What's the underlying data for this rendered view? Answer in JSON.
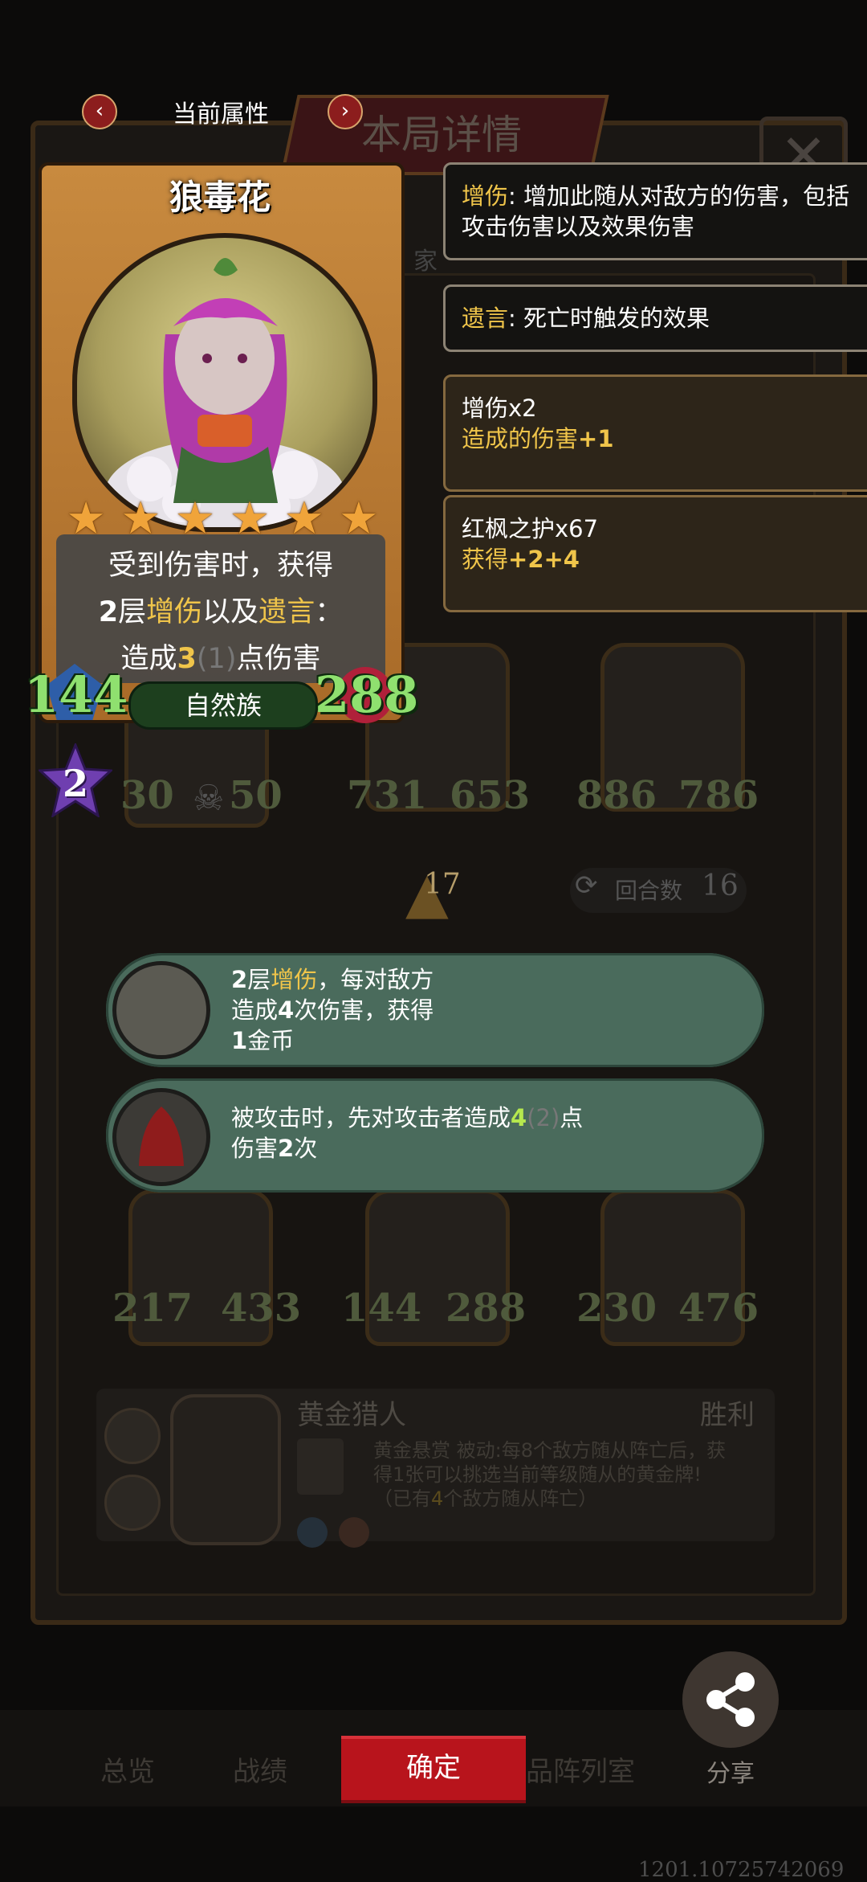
{
  "nav": {
    "title": "当前属性",
    "prev": "‹",
    "next": "›"
  },
  "background": {
    "title": "本局详情",
    "close": "✕",
    "bg_label_1": "家",
    "turn_label": "回合数",
    "turn_value": "16",
    "center_value": "17",
    "row1": [
      {
        "atk": "30",
        "hp": "50"
      },
      {
        "atk": "731",
        "hp": "653"
      },
      {
        "atk": "886",
        "hp": "786"
      }
    ],
    "row3": [
      {
        "atk": "217",
        "hp": "433"
      },
      {
        "atk": "144",
        "hp": "288"
      },
      {
        "atk": "230",
        "hp": "476"
      }
    ],
    "hero_name": "黄金猎人",
    "result": "胜利",
    "hero_skill_title": "黄金悬赏",
    "hero_skill_tag": "被动",
    "hero_skill_desc_1": ":每8个敌方随从阵亡后，获",
    "hero_skill_desc_2": "得1张可以挑选当前等级随从的黄金牌!",
    "hero_skill_progress_pre": "（已有",
    "hero_skill_progress_num": "4",
    "hero_skill_progress_post": "个敌方随从阵亡）"
  },
  "card": {
    "name": "狼毒花",
    "stars": 6,
    "desc_line1": "受到伤害时，获得",
    "desc_line2_num": "2",
    "desc_line2_a": "层",
    "desc_line2_kw1": "增伤",
    "desc_line2_b": "以及",
    "desc_line2_kw2": "遗言",
    "desc_line2_c": "：",
    "desc_line3_a": "造成",
    "desc_line3_num": "3",
    "desc_line3_dim": "(1)",
    "desc_line3_b": "点伤害",
    "tribe": "自然族",
    "attack": "144",
    "health": "288",
    "tier": "2"
  },
  "info_boxes": [
    {
      "keyword": "增伤",
      "text": ": 增加此随从对敌方的伤害，包括攻击伤害以及效果伤害"
    },
    {
      "keyword": "遗言",
      "text": ": 死亡时触发的效果"
    },
    {
      "title": "增伤x2",
      "detail_pre": "造成的伤害",
      "detail_val": "+1"
    },
    {
      "title": "红枫之护x67",
      "detail_pre": "获得",
      "detail_val": "+2+4"
    }
  ],
  "tooltips": [
    {
      "l1_num": "2",
      "l1_a": "层",
      "l1_kw": "增伤",
      "l1_b": "，每对敌方",
      "l2_a": "造成",
      "l2_num": "4",
      "l2_b": "次伤害，获得",
      "l3_num": "1",
      "l3_a": "金币"
    },
    {
      "l1_a": "被攻击时，先对攻击者造成",
      "l1_num": "4",
      "l1_dim": "(2)",
      "l1_b": "点",
      "l2_a": "伤害",
      "l2_num": "2",
      "l2_b": "次"
    }
  ],
  "bottom": {
    "tab1": "总览",
    "tab2": "战绩",
    "confirm": "确定",
    "tab4": "品阵列室",
    "share": "分享"
  },
  "version": "1201.10725742069",
  "colors": {
    "keyword": "#f0c54a",
    "stat_green": "#8fe06f",
    "confirm_red": "#b8141c",
    "pill": "#4a6b5c"
  }
}
